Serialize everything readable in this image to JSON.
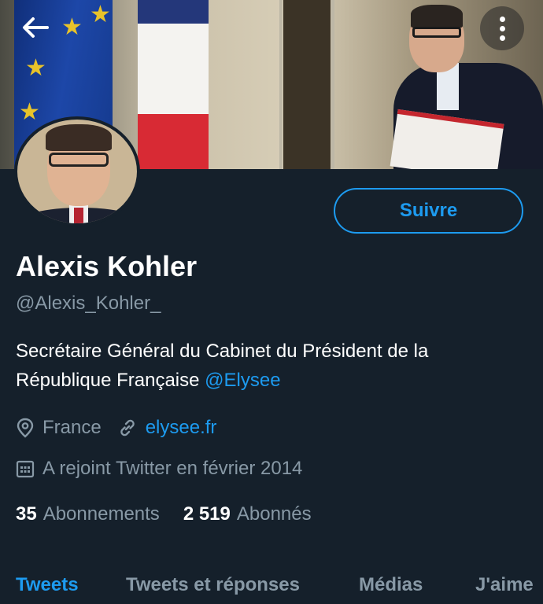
{
  "banner": {
    "back_icon": "arrow-left-icon",
    "more_icon": "more-vertical-icon"
  },
  "profile": {
    "follow_label": "Suivre",
    "name": "Alexis Kohler",
    "handle": "@Alexis_Kohler_",
    "bio_text": "Secrétaire Général du Cabinet du Président de la République Française ",
    "bio_mention": "@Elysee",
    "location": "France",
    "website": "elysee.fr",
    "joined": "A rejoint Twitter en février 2014"
  },
  "stats": {
    "following_count": "35",
    "following_label": "Abonnements",
    "followers_count": "2 519",
    "followers_label": "Abonnés"
  },
  "tabs": [
    {
      "label": "Tweets"
    },
    {
      "label": "Tweets et réponses"
    },
    {
      "label": "Médias"
    },
    {
      "label": "J'aime"
    }
  ],
  "colors": {
    "background": "#15202b",
    "accent": "#1d9bf0",
    "secondary_text": "#8899a6"
  }
}
